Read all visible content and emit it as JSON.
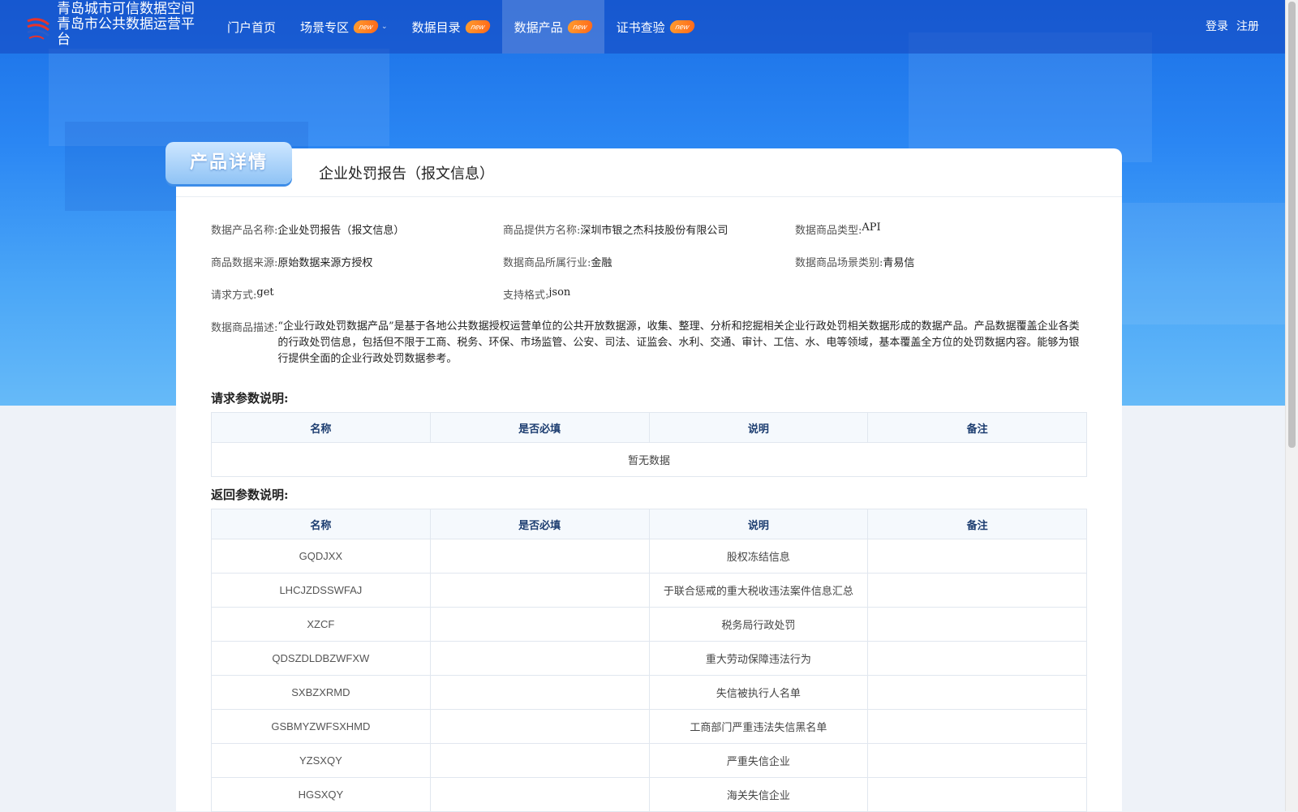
{
  "header": {
    "site_title_line1": "青岛城市可信数据空间",
    "site_title_line2": "青岛市公共数据运营平台",
    "nav": [
      {
        "label": "门户首页",
        "badge": ""
      },
      {
        "label": "场景专区",
        "badge": "new"
      },
      {
        "label": "数据目录",
        "badge": "new"
      },
      {
        "label": "数据产品",
        "badge": "new"
      },
      {
        "label": "证书查验",
        "badge": "new"
      }
    ],
    "login": "登录",
    "register": "注册"
  },
  "detail": {
    "tag": "产品详情",
    "title": "企业处罚报告（报文信息）",
    "fields": {
      "product_name_label": "数据产品名称:",
      "product_name": "企业处罚报告（报文信息）",
      "provider_label": "商品提供方名称:",
      "provider": "深圳市银之杰科技股份有限公司",
      "type_label": "数据商品类型:",
      "type": "API",
      "source_label": "商品数据来源:",
      "source": "原始数据来源方授权",
      "industry_label": "数据商品所属行业:",
      "industry": "金融",
      "scene_label": "数据商品场景类别:",
      "scene": "青易信",
      "method_label": "请求方式:",
      "method": "get",
      "format_label": "支持格式:",
      "format": "json",
      "desc_label": "数据商品描述:",
      "desc": "“企业行政处罚数据产品”是基于各地公共数据授权运营单位的公共开放数据源，收集、整理、分析和挖掘相关企业行政处罚相关数据形成的数据产品。产品数据覆盖企业各类的行政处罚信息，包括但不限于工商、税务、环保、市场监管、公安、司法、证监会、水利、交通、审计、工信、水、电等领域，基本覆盖全方位的处罚数据内容。能够为银行提供全面的企业行政处罚数据参考。"
    }
  },
  "request_params": {
    "title": "请求参数说明:",
    "headers": [
      "名称",
      "是否必填",
      "说明",
      "备注"
    ],
    "empty": "暂无数据"
  },
  "response_params": {
    "title": "返回参数说明:",
    "headers": [
      "名称",
      "是否必填",
      "说明",
      "备注"
    ],
    "rows": [
      {
        "name": "GQDJXX",
        "required": "",
        "desc": "股权冻结信息",
        "note": ""
      },
      {
        "name": "LHCJZDSSWFAJ",
        "required": "",
        "desc": "于联合惩戒的重大税收违法案件信息汇总",
        "note": ""
      },
      {
        "name": "XZCF",
        "required": "",
        "desc": "税务局行政处罚",
        "note": ""
      },
      {
        "name": "QDSZDLDBZWFXW",
        "required": "",
        "desc": "重大劳动保障违法行为",
        "note": ""
      },
      {
        "name": "SXBZXRMD",
        "required": "",
        "desc": "失信被执行人名单",
        "note": ""
      },
      {
        "name": "GSBMYZWFSXHMD",
        "required": "",
        "desc": "工商部门严重违法失信黑名单",
        "note": ""
      },
      {
        "name": "YZSXQY",
        "required": "",
        "desc": "严重失信企业",
        "note": ""
      },
      {
        "name": "HGSXQY",
        "required": "",
        "desc": "海关失信企业",
        "note": ""
      }
    ]
  },
  "colors": {
    "primary": "#1a6fe6",
    "badge": "#ff7a1f",
    "table_header": "#f5f9fd"
  }
}
